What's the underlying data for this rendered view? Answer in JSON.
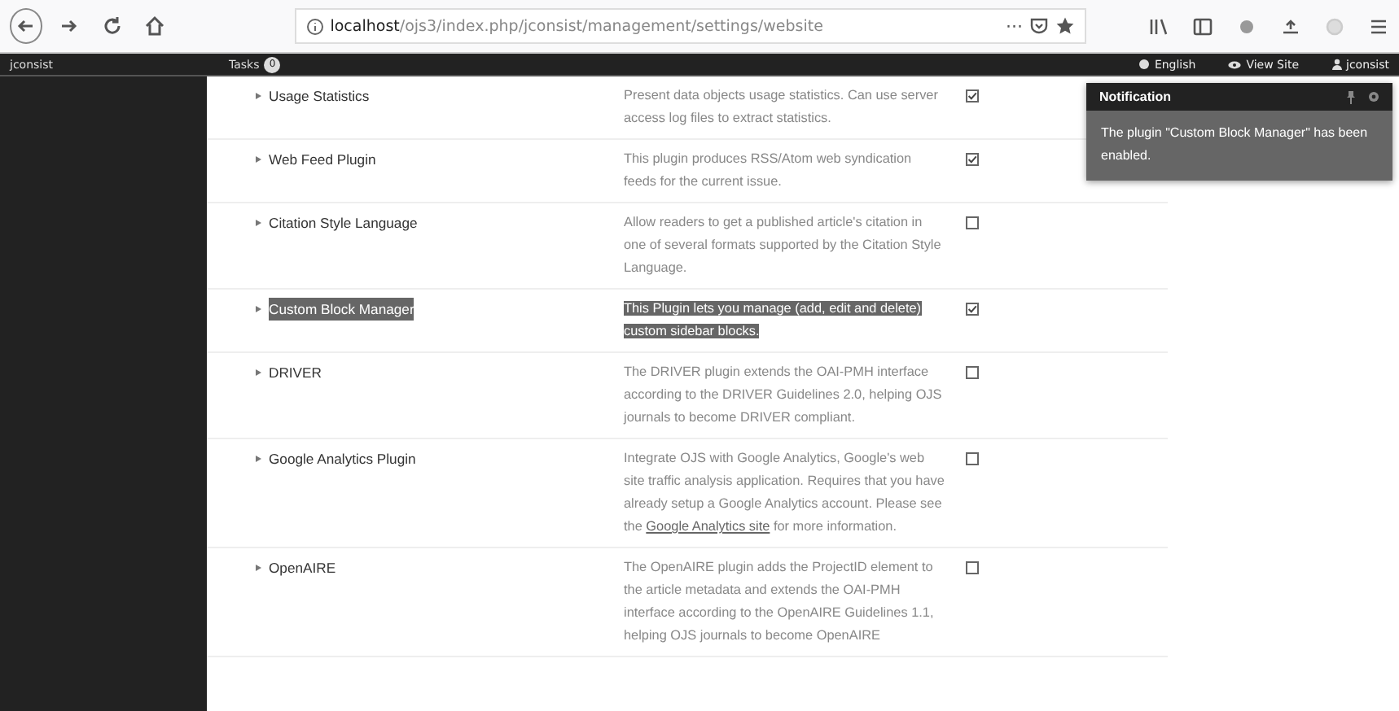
{
  "browser": {
    "url_host": "localhost",
    "url_path": "/ojs3/index.php/jconsist/management/settings/website",
    "page_actions": "···"
  },
  "nav": {
    "site": "jconsist",
    "tasks_label": "Tasks",
    "tasks_count": "0",
    "language": "English",
    "view_site": "View Site",
    "user": "jconsist"
  },
  "plugins": [
    {
      "name": "Usage Statistics",
      "description": [
        {
          "kind": "text",
          "text": "Present data objects usage statistics. Can use server access log files to extract statistics."
        }
      ],
      "enabled": true,
      "highlighted": false
    },
    {
      "name": "Web Feed Plugin",
      "description": [
        {
          "kind": "text",
          "text": "This plugin produces RSS/Atom web syndication feeds for the current issue."
        }
      ],
      "enabled": true,
      "highlighted": false
    },
    {
      "name": "Citation Style Language",
      "description": [
        {
          "kind": "text",
          "text": "Allow readers to get a published article's citation in one of several formats supported by the Citation Style Language."
        }
      ],
      "enabled": false,
      "highlighted": false
    },
    {
      "name": "Custom Block Manager",
      "description": [
        {
          "kind": "text",
          "text": "This Plugin lets you manage (add, edit and delete) custom sidebar blocks."
        }
      ],
      "enabled": true,
      "highlighted": true
    },
    {
      "name": "DRIVER",
      "description": [
        {
          "kind": "text",
          "text": "The DRIVER plugin extends the OAI-PMH interface according to the DRIVER Guidelines 2.0, helping OJS journals to become DRIVER compliant."
        }
      ],
      "enabled": false,
      "highlighted": false
    },
    {
      "name": "Google Analytics Plugin",
      "description": [
        {
          "kind": "text",
          "text": "Integrate OJS with Google Analytics, Google's web site traffic analysis application. Requires that you have already setup a Google Analytics account. Please see the "
        },
        {
          "kind": "link",
          "text": "Google Analytics site"
        },
        {
          "kind": "text",
          "text": " for more information."
        }
      ],
      "enabled": false,
      "highlighted": false
    },
    {
      "name": "OpenAIRE",
      "description": [
        {
          "kind": "text",
          "text": "The OpenAIRE plugin adds the ProjectID element to the article metadata and extends the OAI-PMH interface according to the OpenAIRE Guidelines 1.1, helping OJS journals to become OpenAIRE"
        }
      ],
      "enabled": false,
      "highlighted": false
    }
  ],
  "notification": {
    "title": "Notification",
    "message": "The plugin \"Custom Block Manager\" has been enabled."
  }
}
